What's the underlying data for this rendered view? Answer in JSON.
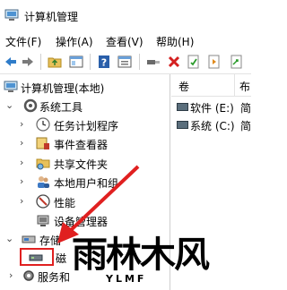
{
  "window": {
    "title": "计算机管理"
  },
  "menu": {
    "file": "文件(F)",
    "action": "操作(A)",
    "view": "查看(V)",
    "help": "帮助(H)"
  },
  "toolbar": {
    "icons": [
      "back-arrow-icon",
      "forward-arrow-icon",
      "folder-up-icon",
      "show-hide-tree-icon",
      "help-icon",
      "properties-icon",
      "connect-icon",
      "delete-icon",
      "check-icon",
      "refresh-icon",
      "export-icon"
    ]
  },
  "tree": {
    "root": "计算机管理(本地)",
    "system_tools": "系统工具",
    "task_scheduler": "任务计划程序",
    "event_viewer": "事件查看器",
    "shared_folders": "共享文件夹",
    "local_users": "本地用户和组",
    "performance": "性能",
    "device_manager": "设备管理器",
    "storage": "存储",
    "disk_mgmt": "磁",
    "services": "服务和"
  },
  "list": {
    "col_volume": "卷",
    "col_layout": "布",
    "rows": [
      {
        "name": "软件 (E:)",
        "layout": "简"
      },
      {
        "name": "系统 (C:)",
        "layout": "简"
      }
    ]
  },
  "watermark": {
    "main": "雨林木风",
    "sub": "YLMF"
  },
  "colors": {
    "accent_blue": "#1f6fc5",
    "arrow_red": "#e02020",
    "highlight_box": "#e02020"
  }
}
